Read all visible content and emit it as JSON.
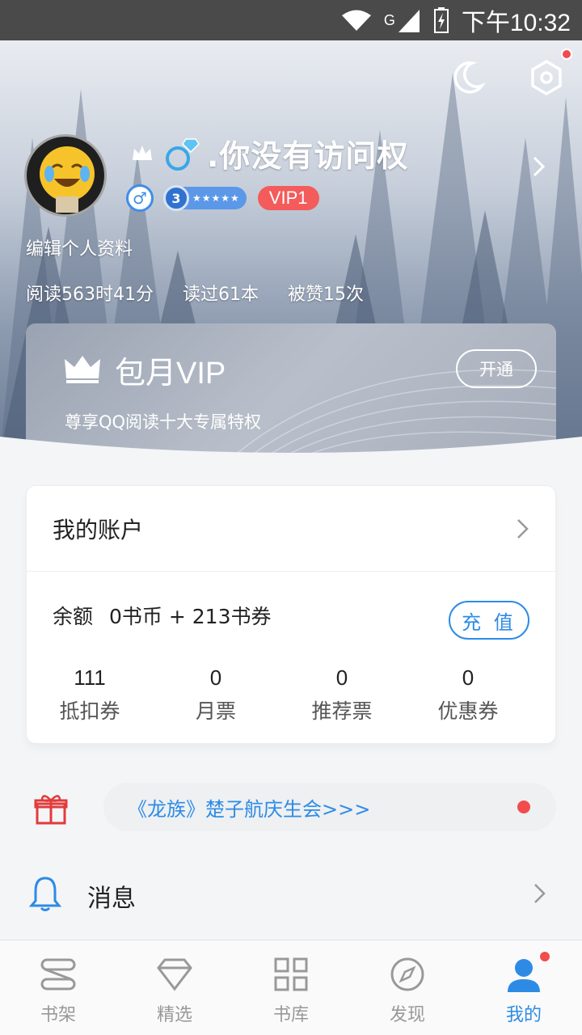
{
  "status_bar": {
    "time": "下午10:32",
    "network": "G"
  },
  "profile": {
    "nickname": ".你没有访问权",
    "level": "3",
    "vip_badge": "VIP1",
    "edit_label": "编辑个人资料",
    "stats": [
      "阅读563时41分",
      "读过61本",
      "被赞15次"
    ]
  },
  "vip_card": {
    "title": "包月VIP",
    "subtitle": "尊享QQ阅读十大专属特权",
    "button": "开通"
  },
  "account": {
    "title": "我的账户",
    "balance_label": "余额",
    "balance_value": "0书币 + 213书券",
    "recharge": "充 值",
    "tickets": [
      {
        "value": "111",
        "label": "抵扣券"
      },
      {
        "value": "0",
        "label": "月票"
      },
      {
        "value": "0",
        "label": "推荐票"
      },
      {
        "value": "0",
        "label": "优惠券"
      }
    ]
  },
  "promo": {
    "text": "《龙族》楚子航庆生会>>>"
  },
  "messages": {
    "label": "消息"
  },
  "tabs": [
    {
      "label": "书架",
      "icon": "bookshelf-icon"
    },
    {
      "label": "精选",
      "icon": "diamond-icon"
    },
    {
      "label": "书库",
      "icon": "grid-icon"
    },
    {
      "label": "发现",
      "icon": "compass-icon"
    },
    {
      "label": "我的",
      "icon": "person-icon"
    }
  ],
  "colors": {
    "accent": "#2d8be6",
    "vip_red": "#f45b5b",
    "notify_red": "#f24c4c"
  }
}
